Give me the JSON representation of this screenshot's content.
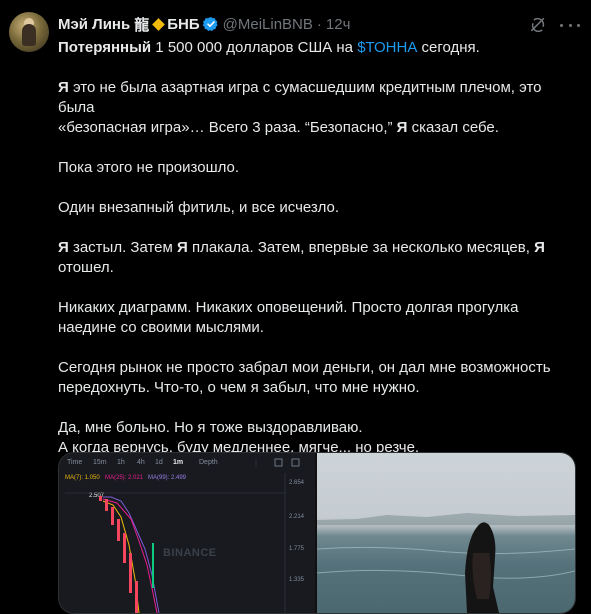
{
  "tweet": {
    "author_name": "Мэй Линь",
    "name_suffix": "龍",
    "affiliate": "БНБ",
    "handle": "@MeiLinBNB",
    "separator": "·",
    "time": "12ч",
    "icons": {
      "affiliate_icon": "diamond-icon",
      "verified_icon": "verified-badge-icon",
      "grok_icon": "grok-icon",
      "more_icon": "more-icon"
    },
    "colors": {
      "accent": "#1d9bf0",
      "affiliate": "#f0b90b",
      "muted": "#71767b"
    },
    "p1": {
      "a": "Потерянный",
      "b": " 1 500 000 долларов США на ",
      "cash": "$ТОННА",
      "c": " сегодня."
    },
    "p2": {
      "a": "Я",
      "b": " это не была азартная игра с сумасшедшим кредитным плечом, это была",
      "c": "«безопасная игра»… Всего 3 раза. “Безопасно,” ",
      "d": "Я",
      "e": " сказал себе."
    },
    "p3": "Пока этого не произошло.",
    "p4": "Один внезапный фитиль, и все исчезло.",
    "p5": {
      "a": "Я",
      "b": " застыл. Затем ",
      "c": "Я",
      "d": " плакала. Затем, впервые за несколько месяцев, ",
      "e": "Я",
      "f": "отошел."
    },
    "p6": {
      "l1": "Никаких диаграмм. Никаких оповещений. Просто долгая прогулка",
      "l2": "наедине со своими мыслями."
    },
    "p7": {
      "l1": "Сегодня рынок не просто забрал мои деньги, он дал мне возможность",
      "l2": "передохнуть. Что-то, о чем я забыл, что мне нужно."
    },
    "p8": {
      "l1": "Да, мне больно. Но я тоже выздоравливаю.",
      "l2": "А когда вернусь, буду медленнее, мягче... но резче."
    }
  },
  "chart_screenshot": {
    "timeframes": [
      "Time",
      "15m",
      "1h",
      "4h",
      "1d",
      "1m",
      "Depth"
    ],
    "active_timeframe": "1m",
    "ma7": "MA(7): 1.050",
    "ma25": "MA(25): 2.021",
    "ma99": "MA(99): 2.499",
    "high_label": "2.507",
    "price_labels": [
      "2.654",
      "2.214",
      "1.775",
      "1.335"
    ],
    "watermark": "BINANCE",
    "colors": {
      "ma7": "#f0b90b",
      "ma25": "#e91e8c",
      "ma99": "#7b5cd6",
      "down": "#f6465d",
      "up": "#0ecb81"
    }
  }
}
